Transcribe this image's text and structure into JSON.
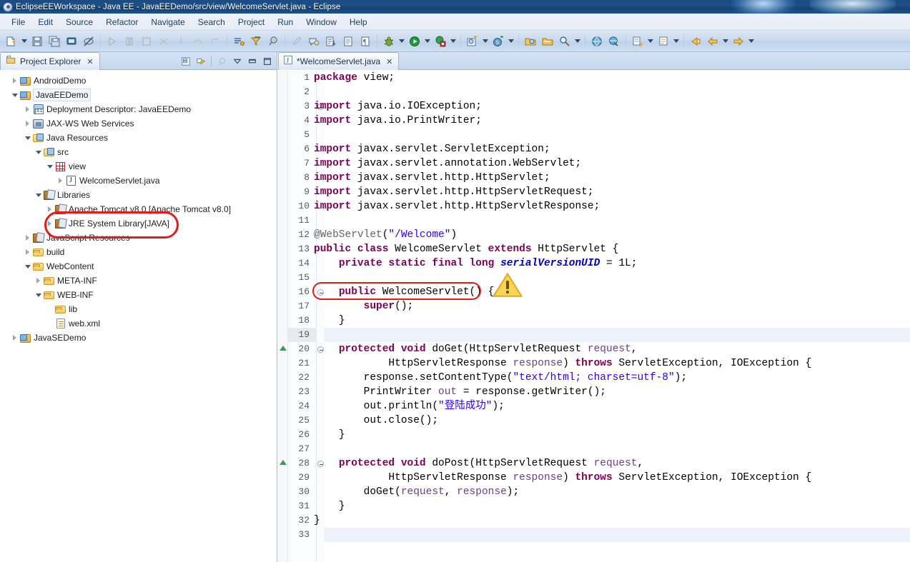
{
  "window": {
    "title": "EclipseEEWorkspace - Java EE - JavaEEDemo/src/view/WelcomeServlet.java - Eclipse",
    "app_icon": "eclipse-icon"
  },
  "menubar": {
    "items": [
      "File",
      "Edit",
      "Source",
      "Refactor",
      "Navigate",
      "Search",
      "Project",
      "Run",
      "Window",
      "Help"
    ]
  },
  "toolbar": {
    "groups": [
      {
        "buttons": [
          {
            "name": "new-wizard-icon",
            "dropdown": true
          },
          {
            "name": "save-icon",
            "dropdown": false
          },
          {
            "name": "save-all-icon",
            "dropdown": false
          },
          {
            "name": "print-icon",
            "dropdown": false
          },
          {
            "name": "toggle-breakpoint-skip-icon",
            "dropdown": false
          }
        ]
      },
      {
        "buttons": [
          {
            "name": "resume-icon",
            "dropdown": false
          },
          {
            "name": "suspend-icon",
            "dropdown": false
          },
          {
            "name": "terminate-icon",
            "dropdown": false
          },
          {
            "name": "disconnect-icon",
            "dropdown": false
          },
          {
            "name": "step-into-icon",
            "dropdown": false
          },
          {
            "name": "step-over-icon",
            "dropdown": false
          },
          {
            "name": "step-return-icon",
            "dropdown": false
          }
        ]
      },
      {
        "buttons": [
          {
            "name": "open-task-icon",
            "dropdown": false
          },
          {
            "name": "filter-icon",
            "dropdown": false
          },
          {
            "name": "pin-icon",
            "dropdown": false
          }
        ]
      },
      {
        "buttons": [
          {
            "name": "paintbrush-icon",
            "dropdown": false
          },
          {
            "name": "annotation-icon",
            "dropdown": false
          },
          {
            "name": "toggle-mark-occurrences-icon",
            "dropdown": false
          },
          {
            "name": "show-whitespace-icon",
            "dropdown": false
          },
          {
            "name": "pilcrow-icon",
            "dropdown": false
          }
        ]
      },
      {
        "buttons": [
          {
            "name": "debug-icon",
            "dropdown": true
          },
          {
            "name": "run-icon",
            "dropdown": true
          },
          {
            "name": "run-external-tools-icon",
            "dropdown": true
          }
        ]
      },
      {
        "buttons": [
          {
            "name": "new-java-project-icon",
            "dropdown": true
          },
          {
            "name": "new-servlet-icon",
            "dropdown": true
          }
        ]
      },
      {
        "buttons": [
          {
            "name": "open-type-icon",
            "dropdown": false
          },
          {
            "name": "open-task-folder-icon",
            "dropdown": false
          },
          {
            "name": "search-icon",
            "dropdown": true
          }
        ]
      },
      {
        "buttons": [
          {
            "name": "web-browser-icon",
            "dropdown": false
          },
          {
            "name": "open-web-icon",
            "dropdown": false
          }
        ]
      },
      {
        "buttons": [
          {
            "name": "next-annotation-icon",
            "dropdown": true
          },
          {
            "name": "previous-annotation-icon",
            "dropdown": true
          }
        ]
      },
      {
        "buttons": [
          {
            "name": "back-history-icon",
            "dropdown": false
          },
          {
            "name": "back-icon",
            "dropdown": true
          },
          {
            "name": "forward-icon",
            "dropdown": true
          }
        ]
      }
    ]
  },
  "project_explorer": {
    "tab_label": "Project Explorer",
    "tab_close": "✕",
    "tab_icon": "project-explorer-icon",
    "toolbar": [
      {
        "name": "collapse-all-icon"
      },
      {
        "name": "link-with-editor-icon"
      },
      {
        "name": "focus-on-active-task-icon"
      },
      {
        "name": "view-menu-icon"
      },
      {
        "name": "minimize-view-icon"
      },
      {
        "name": "maximize-view-icon"
      }
    ],
    "tree": [
      {
        "label": "AndroidDemo",
        "indent": 0,
        "state": "collapsed",
        "icon": "project-icon"
      },
      {
        "label": "JavaEEDemo",
        "indent": 0,
        "state": "expanded",
        "icon": "project-icon",
        "selected": true
      },
      {
        "label": "Deployment Descriptor: JavaEEDemo",
        "indent": 1,
        "state": "collapsed",
        "icon": "deployment-descriptor-icon"
      },
      {
        "label": "JAX-WS Web Services",
        "indent": 1,
        "state": "collapsed",
        "icon": "web-services-icon"
      },
      {
        "label": "Java Resources",
        "indent": 1,
        "state": "expanded",
        "icon": "java-resources-icon"
      },
      {
        "label": "src",
        "indent": 2,
        "state": "expanded",
        "icon": "source-folder-icon"
      },
      {
        "label": "view",
        "indent": 3,
        "state": "expanded",
        "icon": "package-icon"
      },
      {
        "label": "WelcomeServlet.java",
        "indent": 4,
        "state": "collapsed",
        "icon": "java-file-icon"
      },
      {
        "label": "Libraries",
        "indent": 2,
        "state": "expanded",
        "icon": "library-icon"
      },
      {
        "label": "Apache Tomcat v8.0 [Apache Tomcat v8.0]",
        "indent": 3,
        "state": "collapsed",
        "icon": "library-icon"
      },
      {
        "label": "JRE System Library",
        "suffix": " [JAVA]",
        "indent": 3,
        "state": "collapsed",
        "icon": "library-icon"
      },
      {
        "label": "JavaScript Resources",
        "indent": 1,
        "state": "collapsed",
        "icon": "library-icon"
      },
      {
        "label": "build",
        "indent": 1,
        "state": "collapsed",
        "icon": "folder-icon"
      },
      {
        "label": "WebContent",
        "indent": 1,
        "state": "expanded",
        "icon": "folder-icon"
      },
      {
        "label": "META-INF",
        "indent": 2,
        "state": "collapsed",
        "icon": "folder-icon"
      },
      {
        "label": "WEB-INF",
        "indent": 2,
        "state": "expanded",
        "icon": "folder-icon"
      },
      {
        "label": "lib",
        "indent": 3,
        "state": "leaf",
        "icon": "folder-icon"
      },
      {
        "label": "web.xml",
        "indent": 3,
        "state": "leaf",
        "icon": "xml-file-icon"
      },
      {
        "label": "JavaSEDemo",
        "indent": 0,
        "state": "collapsed",
        "icon": "project-icon"
      }
    ]
  },
  "editor": {
    "tab_label": "*WelcomeServlet.java",
    "tab_close": "✕",
    "tab_icon": "java-file-icon",
    "current_line": 19,
    "annotations": [
      {
        "name": "warning-marker",
        "line": 12,
        "type": "warning"
      }
    ],
    "lines": [
      {
        "n": 1,
        "segs": [
          {
            "t": "package ",
            "c": "kw"
          },
          {
            "t": "view;",
            "c": "plain"
          }
        ]
      },
      {
        "n": 2,
        "segs": []
      },
      {
        "n": 3,
        "fold": true,
        "segs": [
          {
            "t": "import ",
            "c": "kw"
          },
          {
            "t": "java.io.IOException;",
            "c": "plain"
          }
        ]
      },
      {
        "n": 4,
        "segs": [
          {
            "t": "import ",
            "c": "kw"
          },
          {
            "t": "java.io.PrintWriter;",
            "c": "plain"
          }
        ]
      },
      {
        "n": 5,
        "segs": []
      },
      {
        "n": 6,
        "segs": [
          {
            "t": "import ",
            "c": "kw"
          },
          {
            "t": "javax.servlet.ServletException;",
            "c": "plain"
          }
        ]
      },
      {
        "n": 7,
        "segs": [
          {
            "t": "import ",
            "c": "kw"
          },
          {
            "t": "javax.servlet.annotation.WebServlet;",
            "c": "plain"
          }
        ]
      },
      {
        "n": 8,
        "segs": [
          {
            "t": "import ",
            "c": "kw"
          },
          {
            "t": "javax.servlet.http.HttpServlet;",
            "c": "plain"
          }
        ]
      },
      {
        "n": 9,
        "segs": [
          {
            "t": "import ",
            "c": "kw"
          },
          {
            "t": "javax.servlet.http.HttpServletRequest;",
            "c": "plain"
          }
        ]
      },
      {
        "n": 10,
        "segs": [
          {
            "t": "import ",
            "c": "kw"
          },
          {
            "t": "javax.servlet.http.HttpServletResponse;",
            "c": "plain"
          }
        ]
      },
      {
        "n": 11,
        "segs": []
      },
      {
        "n": 12,
        "segs": [
          {
            "t": "@WebServlet",
            "c": "ann"
          },
          {
            "t": "(",
            "c": "plain"
          },
          {
            "t": "\"/Welcome\"",
            "c": "str"
          },
          {
            "t": ")",
            "c": "plain"
          }
        ]
      },
      {
        "n": 13,
        "segs": [
          {
            "t": "public class ",
            "c": "kw"
          },
          {
            "t": "WelcomeServlet ",
            "c": "plain"
          },
          {
            "t": "extends ",
            "c": "kw"
          },
          {
            "t": "HttpServlet {",
            "c": "plain"
          }
        ]
      },
      {
        "n": 14,
        "segs": [
          {
            "t": "    ",
            "c": "plain"
          },
          {
            "t": "private static final long ",
            "c": "kw"
          },
          {
            "t": "serialVersionUID",
            "c": "fld"
          },
          {
            "t": " = 1L;",
            "c": "plain"
          }
        ]
      },
      {
        "n": 15,
        "segs": []
      },
      {
        "n": 16,
        "fold": true,
        "segs": [
          {
            "t": "    ",
            "c": "plain"
          },
          {
            "t": "public ",
            "c": "kw"
          },
          {
            "t": "WelcomeServlet() {",
            "c": "plain"
          }
        ]
      },
      {
        "n": 17,
        "segs": [
          {
            "t": "        ",
            "c": "plain"
          },
          {
            "t": "super",
            "c": "kw"
          },
          {
            "t": "();",
            "c": "plain"
          }
        ]
      },
      {
        "n": 18,
        "segs": [
          {
            "t": "    }",
            "c": "plain"
          }
        ]
      },
      {
        "n": 19,
        "segs": [],
        "current": true
      },
      {
        "n": 20,
        "fold": true,
        "override": true,
        "segs": [
          {
            "t": "    ",
            "c": "plain"
          },
          {
            "t": "protected void ",
            "c": "kw"
          },
          {
            "t": "doGet(HttpServletRequest ",
            "c": "plain"
          },
          {
            "t": "request",
            "c": "param"
          },
          {
            "t": ",",
            "c": "plain"
          }
        ]
      },
      {
        "n": 21,
        "segs": [
          {
            "t": "            HttpServletResponse ",
            "c": "plain"
          },
          {
            "t": "response",
            "c": "param"
          },
          {
            "t": ") ",
            "c": "plain"
          },
          {
            "t": "throws ",
            "c": "kw"
          },
          {
            "t": "ServletException, IOException {",
            "c": "plain"
          }
        ]
      },
      {
        "n": 22,
        "segs": [
          {
            "t": "        response.setContentType(",
            "c": "plain"
          },
          {
            "t": "\"text/html; charset=utf-8\"",
            "c": "str"
          },
          {
            "t": ");",
            "c": "plain"
          }
        ]
      },
      {
        "n": 23,
        "segs": [
          {
            "t": "        PrintWriter ",
            "c": "plain"
          },
          {
            "t": "out",
            "c": "param"
          },
          {
            "t": " = response.getWriter();",
            "c": "plain"
          }
        ]
      },
      {
        "n": 24,
        "segs": [
          {
            "t": "        out.println(",
            "c": "plain"
          },
          {
            "t": "\"登陆成功\"",
            "c": "str"
          },
          {
            "t": ");",
            "c": "plain"
          }
        ]
      },
      {
        "n": 25,
        "segs": [
          {
            "t": "        out.close();",
            "c": "plain"
          }
        ]
      },
      {
        "n": 26,
        "segs": [
          {
            "t": "    }",
            "c": "plain"
          }
        ]
      },
      {
        "n": 27,
        "segs": []
      },
      {
        "n": 28,
        "fold": true,
        "override": true,
        "segs": [
          {
            "t": "    ",
            "c": "plain"
          },
          {
            "t": "protected void ",
            "c": "kw"
          },
          {
            "t": "doPost(HttpServletRequest ",
            "c": "plain"
          },
          {
            "t": "request",
            "c": "param"
          },
          {
            "t": ",",
            "c": "plain"
          }
        ]
      },
      {
        "n": 29,
        "segs": [
          {
            "t": "            HttpServletResponse ",
            "c": "plain"
          },
          {
            "t": "response",
            "c": "param"
          },
          {
            "t": ") ",
            "c": "plain"
          },
          {
            "t": "throws ",
            "c": "kw"
          },
          {
            "t": "ServletException, IOException {",
            "c": "plain"
          }
        ]
      },
      {
        "n": 30,
        "segs": [
          {
            "t": "        doGet(",
            "c": "plain"
          },
          {
            "t": "request",
            "c": "param"
          },
          {
            "t": ", ",
            "c": "plain"
          },
          {
            "t": "response",
            "c": "param"
          },
          {
            "t": ");",
            "c": "plain"
          }
        ]
      },
      {
        "n": 31,
        "segs": [
          {
            "t": "    }",
            "c": "plain"
          }
        ]
      },
      {
        "n": 32,
        "segs": [
          {
            "t": "}",
            "c": "plain"
          }
        ]
      },
      {
        "n": 33,
        "segs": [],
        "lastblank": true
      }
    ]
  },
  "annotations_overlay": {
    "tree_highlight": {
      "name": "red-ellipse-tree",
      "color": "#e21b1b"
    },
    "code_highlight": {
      "name": "red-ellipse-code",
      "color": "#e21b1b"
    },
    "warning_icon": {
      "name": "warning-triangle-icon",
      "color": "#f5c033"
    }
  },
  "colors": {
    "title_bar": "#1b4b81",
    "toolbar": "#c9d9ee",
    "keyword": "#7f0055",
    "string": "#2a00ff",
    "annotation_text": "#646464",
    "field_italic": "#0000c0",
    "red_marker": "#e21b1b"
  }
}
